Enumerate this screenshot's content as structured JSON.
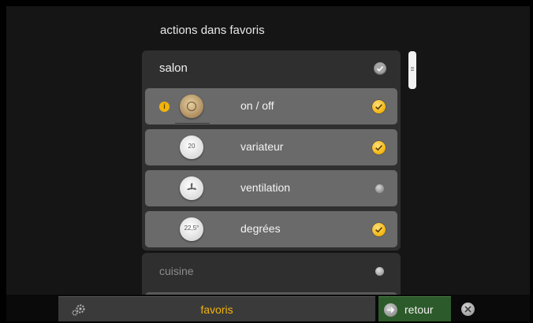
{
  "header": {
    "title": "actions dans favoris"
  },
  "rooms": [
    {
      "label": "salon",
      "selected": true,
      "items": [
        {
          "label": "on / off",
          "icon": "power-toggle-icon",
          "selected": true,
          "info_badge": "i"
        },
        {
          "label": "variateur",
          "icon": "dimmer-icon",
          "value": "20",
          "selected": true
        },
        {
          "label": "ventilation",
          "icon": "fan-icon",
          "selected": false
        },
        {
          "label": "degrées",
          "icon": "thermostat-icon",
          "value": "22,5°",
          "selected": true
        }
      ]
    },
    {
      "label": "cuisine",
      "selected": false
    }
  ],
  "bottom": {
    "settings_icon": "gear-icon",
    "favorites_label": "favoris",
    "back_label": "retour",
    "back_icon": "arrow-right-icon",
    "close_icon": "close-icon"
  },
  "colors": {
    "accent": "#f2b40c",
    "back_button": "#2d5a2a"
  }
}
